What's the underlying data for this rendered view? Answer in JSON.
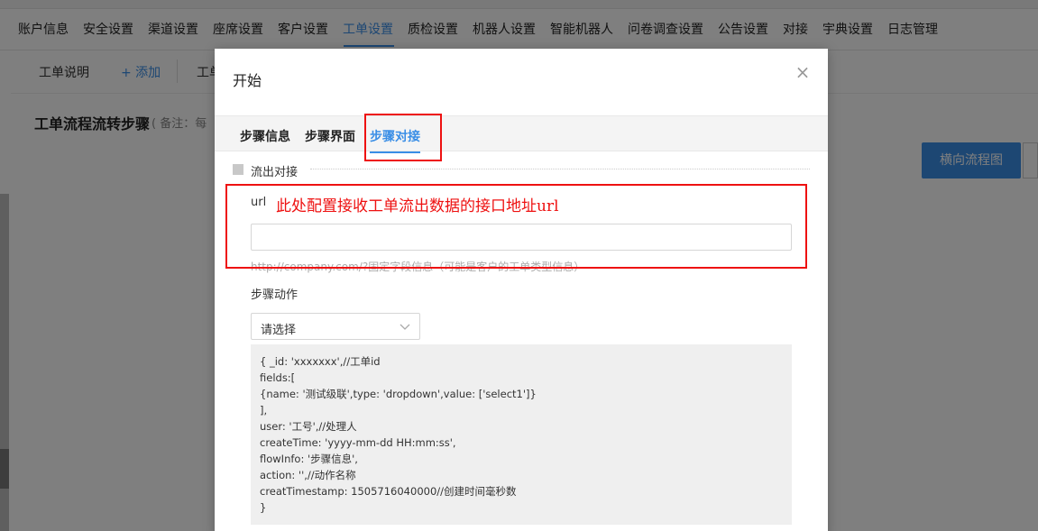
{
  "nav": {
    "items": [
      "账户信息",
      "安全设置",
      "渠道设置",
      "座席设置",
      "客户设置",
      "工单设置",
      "质检设置",
      "机器人设置",
      "智能机器人",
      "问卷调查设置",
      "公告设置",
      "对接",
      "宇典设置",
      "日志管理"
    ],
    "active": "工单设置"
  },
  "subbar": {
    "doc_label": "工单说明",
    "add_label": "+ 添加",
    "partial_label": "工单"
  },
  "section": {
    "title": "工单流程流转步骤",
    "note": "( 备注：每"
  },
  "flow_button": "横向流程图",
  "modal": {
    "title": "开始",
    "close_glyph": "×",
    "tabs": [
      "步骤信息",
      "步骤界面",
      "步骤对接"
    ],
    "active_tab": "步骤对接",
    "legend": "流出对接",
    "url_label": "url",
    "url_annotation": "此处配置接收工单流出数据的接口地址url",
    "url_value": "",
    "url_hint": "http://company.com/?固定字段信息（可能是客户的工单类型信息）",
    "action_label": "步骤动作",
    "action_select_value": "请选择",
    "code_lines": [
      "{ _id: 'xxxxxxx',//工单id",
      "fields:[",
      "{name: '测试级联',type: 'dropdown',value: ['select1']}",
      "],",
      "user: '工号',//处理人",
      "createTime: 'yyyy-mm-dd HH:mm:ss',",
      "flowInfo: '步骤信息',",
      "action: '',//动作名称",
      "creatTimestamp: 1505716040000//创建时间毫秒数",
      "}"
    ]
  },
  "colors": {
    "accent": "#3a8ee6",
    "annotation": "#ee1111",
    "overlay": "rgba(0,0,0,0.5)"
  }
}
